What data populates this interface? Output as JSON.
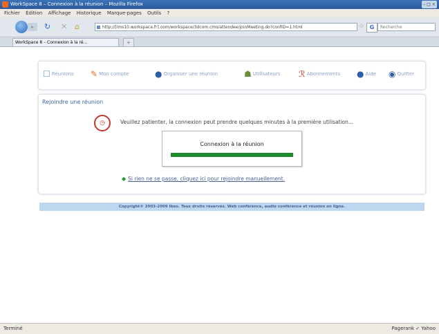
{
  "window": {
    "title": "WorkSpace 8 – Connexion à la réunion – Mozilla Firefox",
    "controls_label": "–  □  ×"
  },
  "menu": [
    "Fichier",
    "Édition",
    "Affichage",
    "Historique",
    "Marque-pages",
    "Outils",
    "?"
  ],
  "toolbar": {
    "url": "http://[ims10.workspace.fr].com/workspace/3dcom.cms/attendee/joinMeeting.do?confID=1.html",
    "search_engine": "G",
    "search_placeholder": "Recherche",
    "back_icon": "back-arrow-icon",
    "reload_icon": "reload-icon",
    "stop_icon": "stop-icon",
    "home_icon": "home-icon"
  },
  "tab": {
    "title": "WorkSpace 8 – Connexion à la ré...",
    "close_label": "×",
    "new_tab_label": "+"
  },
  "nav": [
    {
      "label": "Réunions",
      "icon": "calendar-icon",
      "color": "#6aa0cf"
    },
    {
      "label": "Mon compte",
      "icon": "pencil-icon",
      "color": "#e07020"
    },
    {
      "label": "Organiser une réunion",
      "icon": "meeting-icon",
      "color": "#2c5fa8"
    },
    {
      "label": "Utilisateurs",
      "icon": "users-icon",
      "color": "#6b8e3a"
    },
    {
      "label": "Abonnements",
      "icon": "subscription-icon",
      "color": "#c0392b"
    },
    {
      "label": "Aide",
      "icon": "help-icon",
      "color": "#2c5fa8"
    },
    {
      "label": "Quitter",
      "icon": "quit-icon",
      "color": "#2c5fa8"
    }
  ],
  "join": {
    "title": "Rejoindre une réunion",
    "wait_message": "Veuillez patienter, la connexion peut prendre quelques minutes à la première utilisation...",
    "connection_title": "Connexion à la réunion",
    "progress": 1.0,
    "manual_arrow": "◆",
    "manual_link": "Si rien ne se passe, cliquez ici pour rejoindre manuellement."
  },
  "footer": "Copyright© 2003-2009 Ibeo. Tous droits réservés. Web conférence, audio conférence et réunion en ligne.",
  "status": {
    "left": "Terminé",
    "right": "Pagerank ✓ Yahoo"
  },
  "colors": {
    "accent_blue": "#3c64a8",
    "progress_green": "#1f8a2e",
    "footer_band": "#bcd7ee"
  }
}
